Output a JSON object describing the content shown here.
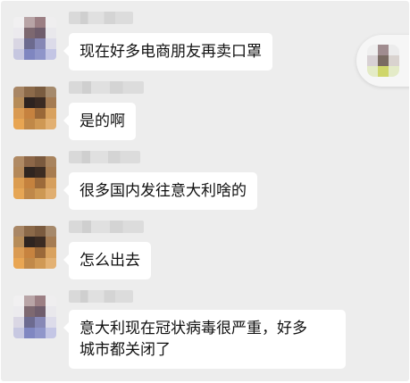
{
  "colors": {
    "chat_background": "#ededed",
    "bubble_background": "#ffffff",
    "text": "#111111"
  },
  "messages": [
    {
      "sender": "user-a",
      "text": "现在好多电商朋友再卖口罩"
    },
    {
      "sender": "user-b",
      "text": "是的啊"
    },
    {
      "sender": "user-c",
      "text": "很多国内发往意大利啥的"
    },
    {
      "sender": "user-b",
      "text": "怎么出去"
    },
    {
      "sender": "user-a",
      "text": "意大利现在冠状病毒很严重，好多\n城市都关闭了"
    }
  ],
  "floating_window": {
    "icon": "floating-avatar-icon"
  }
}
